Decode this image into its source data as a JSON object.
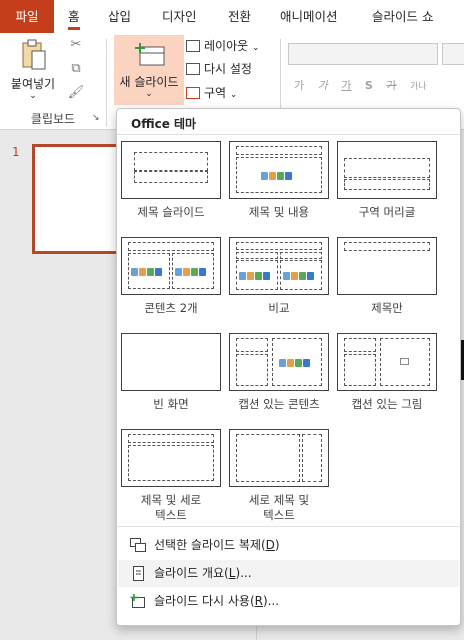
{
  "ribbon": {
    "tabs": [
      "파일",
      "홈",
      "삽입",
      "디자인",
      "전환",
      "애니메이션",
      "슬라이드 쇼"
    ],
    "active_tab": "홈",
    "paste_label": "붙여넣기",
    "clipboard_group_label": "클립보드",
    "new_slide_label": "새 슬라이드",
    "layout_label": "레이아웃",
    "reset_label": "다시 설정",
    "section_label": "구역",
    "format_buttons": [
      "가",
      "가",
      "가",
      "S",
      "가",
      "가나"
    ]
  },
  "thumbnails": {
    "slide_number": "1"
  },
  "dropdown": {
    "title": "Office 테마",
    "layouts": [
      {
        "name": "제목 슬라이드",
        "icon": "title-slide-layout-icon"
      },
      {
        "name": "제목 및 내용",
        "icon": "title-content-layout-icon"
      },
      {
        "name": "구역 머리글",
        "icon": "section-header-layout-icon"
      },
      {
        "name": "콘텐츠 2개",
        "icon": "two-content-layout-icon"
      },
      {
        "name": "비교",
        "icon": "comparison-layout-icon"
      },
      {
        "name": "제목만",
        "icon": "title-only-layout-icon"
      },
      {
        "name": "빈 화면",
        "icon": "blank-layout-icon"
      },
      {
        "name": "캡션 있는 콘텐츠",
        "icon": "content-caption-layout-icon"
      },
      {
        "name": "캡션 있는 그림",
        "icon": "picture-caption-layout-icon"
      },
      {
        "name_line1": "제목 및 세로",
        "name_line2": "텍스트",
        "icon": "title-vertical-text-layout-icon"
      },
      {
        "name_line1": "세로 제목 및",
        "name_line2": "텍스트",
        "icon": "vertical-title-text-layout-icon"
      }
    ],
    "menu": [
      {
        "pre": "선택한 슬라이드 복제(",
        "key": "D",
        "post": ")",
        "icon": "duplicate-slide-icon"
      },
      {
        "pre": "슬라이드 개요(",
        "key": "L",
        "post": ")...",
        "icon": "outline-icon"
      },
      {
        "pre": "슬라이드 다시 사용(",
        "key": "R",
        "post": ")...",
        "icon": "reuse-slides-icon"
      }
    ]
  },
  "colors": {
    "accent": "#c43e1c",
    "new_slide_highlight": "#fad4c0"
  }
}
